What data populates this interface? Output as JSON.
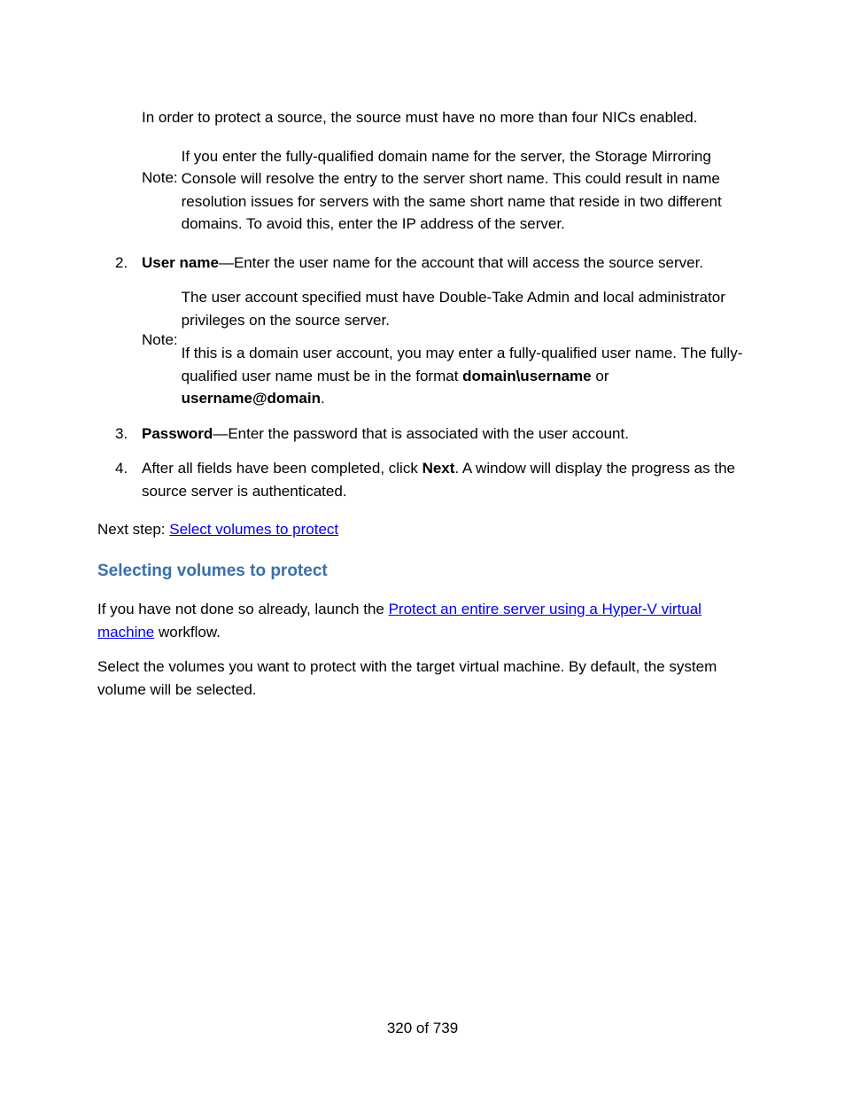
{
  "intro_note_paragraph": "In order to protect a source, the source must have no more than four NICs enabled.",
  "note_label": "Note:",
  "first_note_body": "If you enter the fully-qualified domain name for the server, the Storage Mirroring Console will resolve the entry to the server short name. This could result in name resolution issues for servers with the same short name that reside in two different domains. To avoid this, enter the IP address of the server.",
  "list": {
    "item2": {
      "term": "User name",
      "text": "—Enter the user name for the account that will access the source server.",
      "note_p1": "The user account specified must have Double-Take Admin and local administrator privileges on the source server.",
      "note_p2_pre": "If this is a domain user account, you may enter a fully-qualified user name. The fully-qualified user name must be in the format ",
      "note_p2_bold1": "domain\\username",
      "note_p2_mid": " or ",
      "note_p2_bold2": "username@domain",
      "note_p2_post": "."
    },
    "item3": {
      "term": "Password",
      "text": "—Enter the password that is associated with the user account."
    },
    "item4": {
      "pre": "After all fields have been completed, click ",
      "bold": "Next",
      "post": ". A window will display the progress as the source server is authenticated."
    }
  },
  "next_step_label": "Next step: ",
  "next_step_link": "Select volumes to protect",
  "heading": "Selecting volumes to protect",
  "para_after_heading_pre": "If you have not done so already, launch the ",
  "para_after_heading_link": "Protect an entire server using a Hyper-V virtual machine",
  "para_after_heading_post": " workflow.",
  "last_para": "Select the volumes you want to protect with the target virtual machine. By default, the system volume will be selected.",
  "footer": "320 of 739"
}
